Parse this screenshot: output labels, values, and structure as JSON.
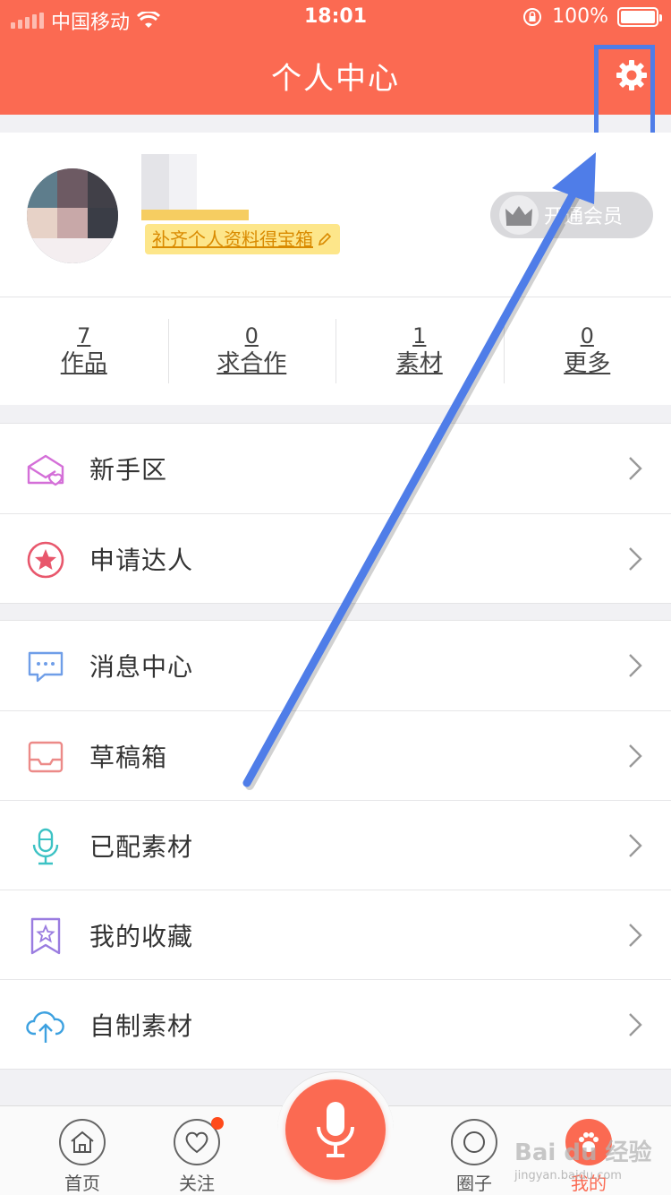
{
  "status": {
    "carrier": "中国移动",
    "time": "18:01",
    "battery": "100%"
  },
  "nav": {
    "title": "个人中心",
    "settings_icon": "gear-icon"
  },
  "profile": {
    "complete_link": "补齐个人资料得宝箱",
    "vip_label": "开通会员"
  },
  "stats": [
    {
      "num": "7",
      "label": "作品"
    },
    {
      "num": "0",
      "label": "求合作"
    },
    {
      "num": "1",
      "label": "素材"
    },
    {
      "num": "0",
      "label": "更多"
    }
  ],
  "group1": [
    {
      "label": "新手区",
      "icon": "envelope-heart-icon"
    },
    {
      "label": "申请达人",
      "icon": "star-badge-icon"
    }
  ],
  "group2": [
    {
      "label": "消息中心",
      "icon": "chat-bubble-icon"
    },
    {
      "label": "草稿箱",
      "icon": "inbox-tray-icon"
    },
    {
      "label": "已配素材",
      "icon": "microphone-icon"
    },
    {
      "label": "我的收藏",
      "icon": "bookmark-star-icon"
    },
    {
      "label": "自制素材",
      "icon": "cloud-upload-icon"
    }
  ],
  "tabbar": {
    "home": "首页",
    "follow": "关注",
    "circle": "圈子",
    "mine": "我的"
  },
  "watermark": {
    "main": "Bai du 经验",
    "sub": "jingyan.baidu.com"
  },
  "colors": {
    "brand": "#fb6a52",
    "annotation": "#4f7de8"
  }
}
